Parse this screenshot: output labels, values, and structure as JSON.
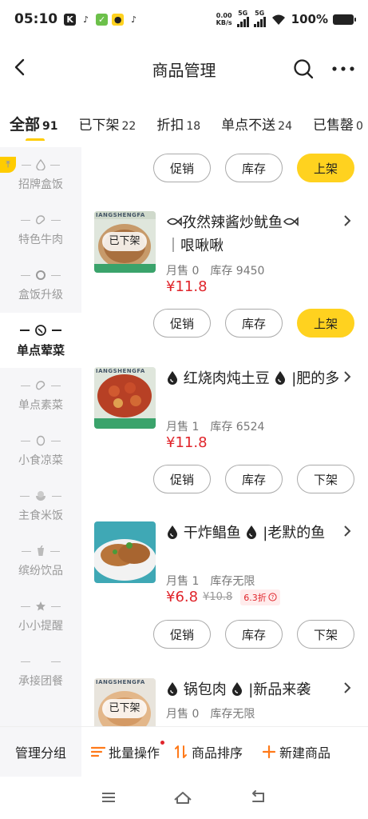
{
  "status_bar": {
    "time": "05:10",
    "net_speed": "0.00",
    "net_unit": "KB/s",
    "sig1": "5G",
    "sig2": "5G",
    "battery": "100%"
  },
  "header": {
    "title": "商品管理"
  },
  "tabs": [
    {
      "label": "全部",
      "count": "91"
    },
    {
      "label": "已下架",
      "count": "22"
    },
    {
      "label": "折扣",
      "count": "18"
    },
    {
      "label": "单点不送",
      "count": "24"
    },
    {
      "label": "已售罄",
      "count": "0"
    }
  ],
  "sidebar": {
    "items": [
      {
        "label": "招牌盒饭"
      },
      {
        "label": "特色牛肉"
      },
      {
        "label": "盒饭升级"
      },
      {
        "label": "单点荤菜"
      },
      {
        "label": "单点素菜"
      },
      {
        "label": "小食凉菜"
      },
      {
        "label": "主食米饭"
      },
      {
        "label": "缤纷饮品"
      },
      {
        "label": "小小提醒"
      },
      {
        "label": "承接团餐"
      }
    ]
  },
  "actions": {
    "promo": "促销",
    "stock": "库存",
    "on_shelf": "上架",
    "off_shelf": "下架"
  },
  "products": [
    {
      "name": "孜然辣酱炒鱿鱼",
      "name_suffix": "｜哏啾啾",
      "sold": "月售 0",
      "stock": "库存 9450",
      "price": "¥11.8",
      "badge": "已下架",
      "thumb_caption": "IANGSHENGFA"
    },
    {
      "name": "红烧肉炖土豆",
      "name_suffix": "|肥的多",
      "sold": "月售 1",
      "stock": "库存 6524",
      "price": "¥11.8",
      "thumb_caption": "IANGSHENGFA"
    },
    {
      "name": "干炸鲳鱼",
      "name_suffix": "|老默的鱼",
      "sold": "月售 1",
      "stock": "库存无限",
      "price": "¥6.8",
      "old_price": "¥10.8",
      "discount": "6.3折"
    },
    {
      "name": "锅包肉",
      "name_suffix": "|新品来袭",
      "sold": "月售 0",
      "stock": "库存无限",
      "badge": "已下架",
      "thumb_caption": "IANGSHENGFA"
    }
  ],
  "bottom_bar": {
    "group": "管理分组",
    "batch": "批量操作",
    "sort": "商品排序",
    "new": "新建商品"
  },
  "colors": {
    "accent": "#ffd21f",
    "price": "#e0252b"
  }
}
